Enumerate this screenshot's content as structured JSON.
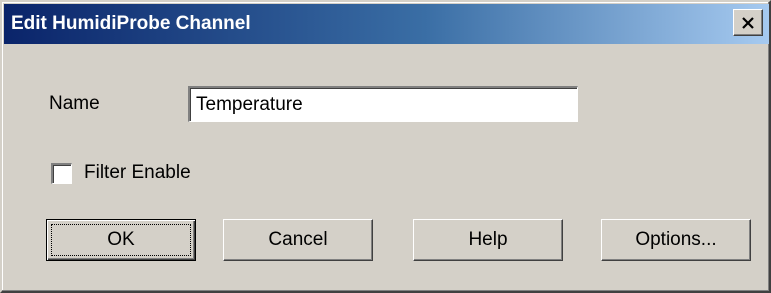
{
  "window": {
    "title": "Edit HumidiProbe Channel",
    "close_glyph": "✕"
  },
  "form": {
    "name_label": "Name",
    "name_value": "Temperature",
    "filter_label": "Filter Enable",
    "filter_checked": false
  },
  "buttons": {
    "ok": "OK",
    "cancel": "Cancel",
    "help": "Help",
    "options": "Options..."
  },
  "colors": {
    "face": "#d4d0c8",
    "title_start": "#0a246a",
    "title_end": "#a6caf0"
  }
}
